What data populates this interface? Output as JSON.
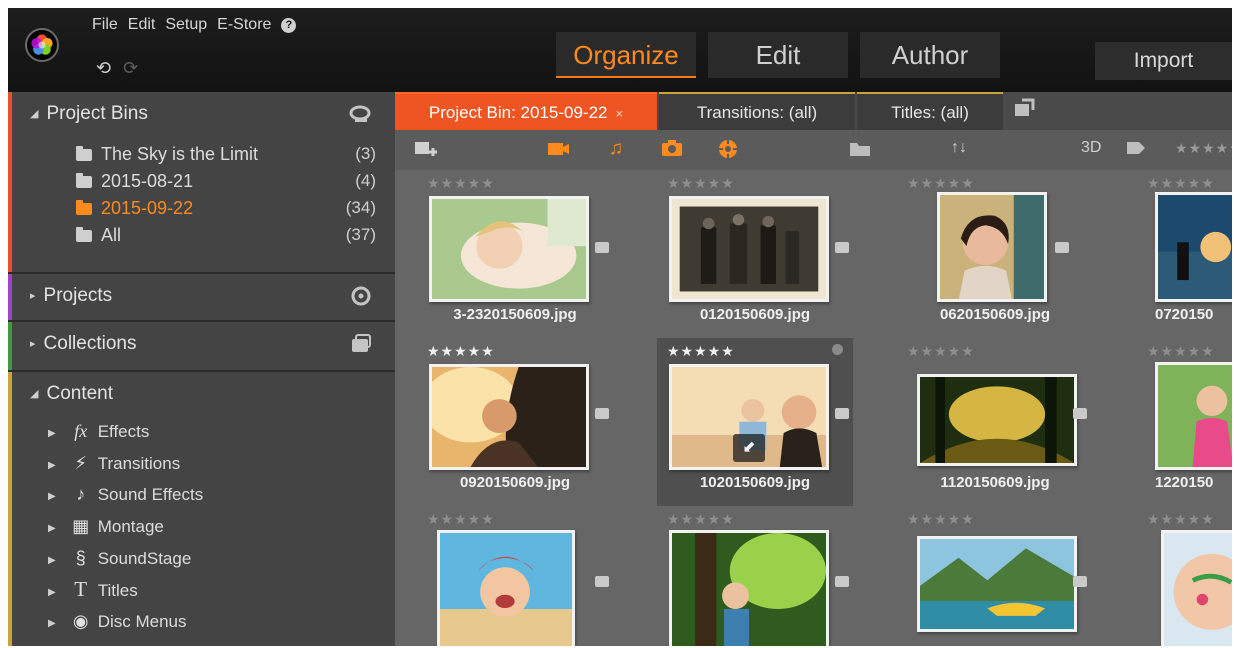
{
  "menu": {
    "file": "File",
    "edit": "Edit",
    "setup": "Setup",
    "estore": "E-Store",
    "help": "?"
  },
  "toolbar": {
    "undo": "⟲",
    "redo": "⟳"
  },
  "modes": {
    "organize": "Organize",
    "edit": "Edit",
    "author": "Author"
  },
  "import_label": "Import",
  "sections": {
    "bins": {
      "title": "Project Bins",
      "items": [
        {
          "label": "The Sky is the Limit",
          "count": "(3)"
        },
        {
          "label": "2015-08-21",
          "count": "(4)"
        },
        {
          "label": "2015-09-22",
          "count": "(34)"
        },
        {
          "label": "All",
          "count": "(37)"
        }
      ]
    },
    "projects": {
      "title": "Projects"
    },
    "collections": {
      "title": "Collections"
    },
    "content": {
      "title": "Content",
      "items": [
        {
          "label": "Effects",
          "icon": "fx"
        },
        {
          "label": "Transitions",
          "icon": "⚡"
        },
        {
          "label": "Sound Effects",
          "icon": "♪"
        },
        {
          "label": "Montage",
          "icon": "▦"
        },
        {
          "label": "SoundStage",
          "icon": "§"
        },
        {
          "label": "Titles",
          "icon": "T"
        },
        {
          "label": "Disc Menus",
          "icon": "◉"
        }
      ]
    }
  },
  "tabs": {
    "bin": "Project Bin: 2015-09-22",
    "bin_close": "×",
    "transitions": "Transitions: (all)",
    "titles": "Titles: (all)"
  },
  "filterbar": {
    "sort": "↑↓",
    "mode3d": "3D"
  },
  "stars_glyph": "★★★★★",
  "colors": {
    "accent_orange": "#ff8a1e",
    "tab_active": "#ee5522"
  },
  "thumbnails": [
    {
      "name": "3-2320150609.jpg",
      "rated": false
    },
    {
      "name": "0120150609.jpg",
      "rated": false
    },
    {
      "name": "0620150609.jpg",
      "rated": false
    },
    {
      "name": "0720150",
      "rated": false
    },
    {
      "name": "0920150609.jpg",
      "rated": true
    },
    {
      "name": "1020150609.jpg",
      "rated": true
    },
    {
      "name": "1120150609.jpg",
      "rated": false
    },
    {
      "name": "1220150",
      "rated": false
    },
    {
      "name": "",
      "rated": false
    },
    {
      "name": "",
      "rated": false
    },
    {
      "name": "",
      "rated": false
    },
    {
      "name": "",
      "rated": false
    }
  ]
}
